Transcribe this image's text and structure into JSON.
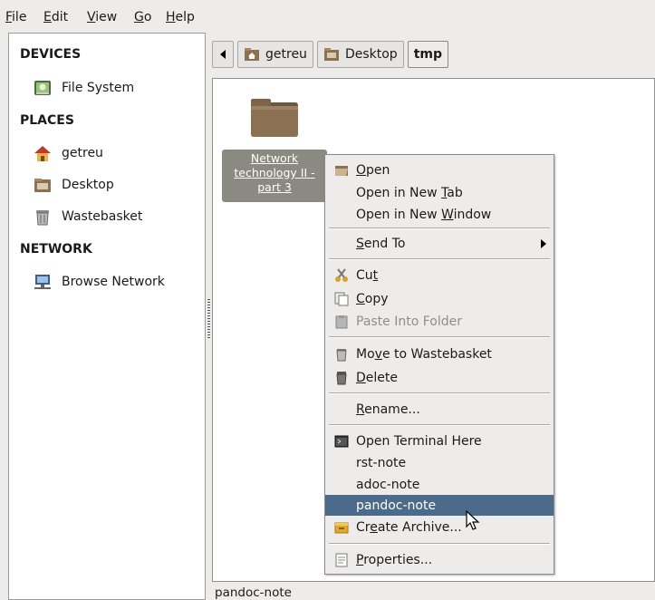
{
  "menubar": [
    {
      "pre": "",
      "acc": "F",
      "post": "ile"
    },
    {
      "pre": "",
      "acc": "E",
      "post": "dit"
    },
    {
      "pre": "",
      "acc": "V",
      "post": "iew"
    },
    {
      "pre": "",
      "acc": "G",
      "post": "o"
    },
    {
      "pre": "",
      "acc": "H",
      "post": "elp"
    }
  ],
  "sidebar": {
    "devices_header": "DEVICES",
    "places_header": "PLACES",
    "network_header": "NETWORK",
    "items": [
      {
        "label": "File System",
        "icon": "harddisk-icon"
      },
      {
        "label": "getreu",
        "icon": "home-folder-icon"
      },
      {
        "label": "Desktop",
        "icon": "desktop-folder-icon"
      },
      {
        "label": "Wastebasket",
        "icon": "trash-icon"
      },
      {
        "label": "Browse Network",
        "icon": "network-icon"
      }
    ]
  },
  "pathbar": {
    "crumbs": [
      "getreu",
      "Desktop",
      "tmp"
    ],
    "active": "tmp"
  },
  "file": {
    "label_line1": "Network",
    "label_line2": "technology II -",
    "label_line3": "part 3"
  },
  "context_menu": {
    "open": {
      "pre": "",
      "acc": "O",
      "post": "pen"
    },
    "open_tab": {
      "pre": "Open in New ",
      "acc": "T",
      "post": "ab"
    },
    "open_window": {
      "pre": "Open in New ",
      "acc": "W",
      "post": "indow"
    },
    "send_to": {
      "pre": "",
      "acc": "S",
      "post": "end To"
    },
    "cut": {
      "pre": "Cu",
      "acc": "t",
      "post": ""
    },
    "copy": {
      "pre": "",
      "acc": "C",
      "post": "opy"
    },
    "paste": "Paste Into Folder",
    "move_trash": {
      "pre": "Mo",
      "acc": "v",
      "post": "e to Wastebasket"
    },
    "delete": {
      "pre": "",
      "acc": "D",
      "post": "elete"
    },
    "rename": {
      "pre": "",
      "acc": "R",
      "post": "ename..."
    },
    "terminal": "Open Terminal Here",
    "rst": "rst-note",
    "adoc": "adoc-note",
    "pandoc": "pandoc-note",
    "archive": {
      "pre": "Cr",
      "acc": "e",
      "post": "ate Archive..."
    },
    "properties": {
      "pre": "",
      "acc": "P",
      "post": "roperties..."
    }
  },
  "statusbar": {
    "text": "pandoc-note"
  },
  "colors": {
    "highlight": "#4c6a8a",
    "selection": "#8a8a82",
    "folder": "#8b7052"
  }
}
